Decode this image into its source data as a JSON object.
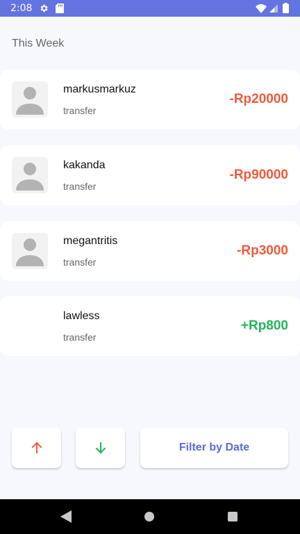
{
  "status_bar": {
    "time": "2:08",
    "icons": [
      "gear-icon",
      "sd-card-icon",
      "wifi-icon",
      "signal-icon",
      "battery-icon"
    ],
    "background": "#6373e0"
  },
  "section_title": "This Week",
  "transactions": [
    {
      "name": "markusmarkuz",
      "type": "transfer",
      "amount": "-Rp20000",
      "avatar": "default-avatar-icon"
    },
    {
      "name": "kakanda",
      "type": "transfer",
      "amount": "-Rp90000",
      "avatar": "default-avatar-icon"
    },
    {
      "name": "megantritis",
      "type": "transfer",
      "amount": "-Rp3000",
      "avatar": "default-avatar-icon"
    },
    {
      "name": "lawless",
      "type": "transfer",
      "amount": "+Rp800",
      "avatar": "none"
    }
  ],
  "colors": {
    "negative": "#f05a3c",
    "positive": "#20b65a",
    "accent": "#5a6ad6",
    "background": "#f7f8fe"
  },
  "actions": {
    "sort_up_icon": "arrow-up-icon",
    "sort_down_icon": "arrow-down-icon",
    "filter_label": "Filter by Date"
  },
  "nav_bar": {
    "icons": [
      "back-icon",
      "home-icon",
      "recents-icon"
    ]
  }
}
